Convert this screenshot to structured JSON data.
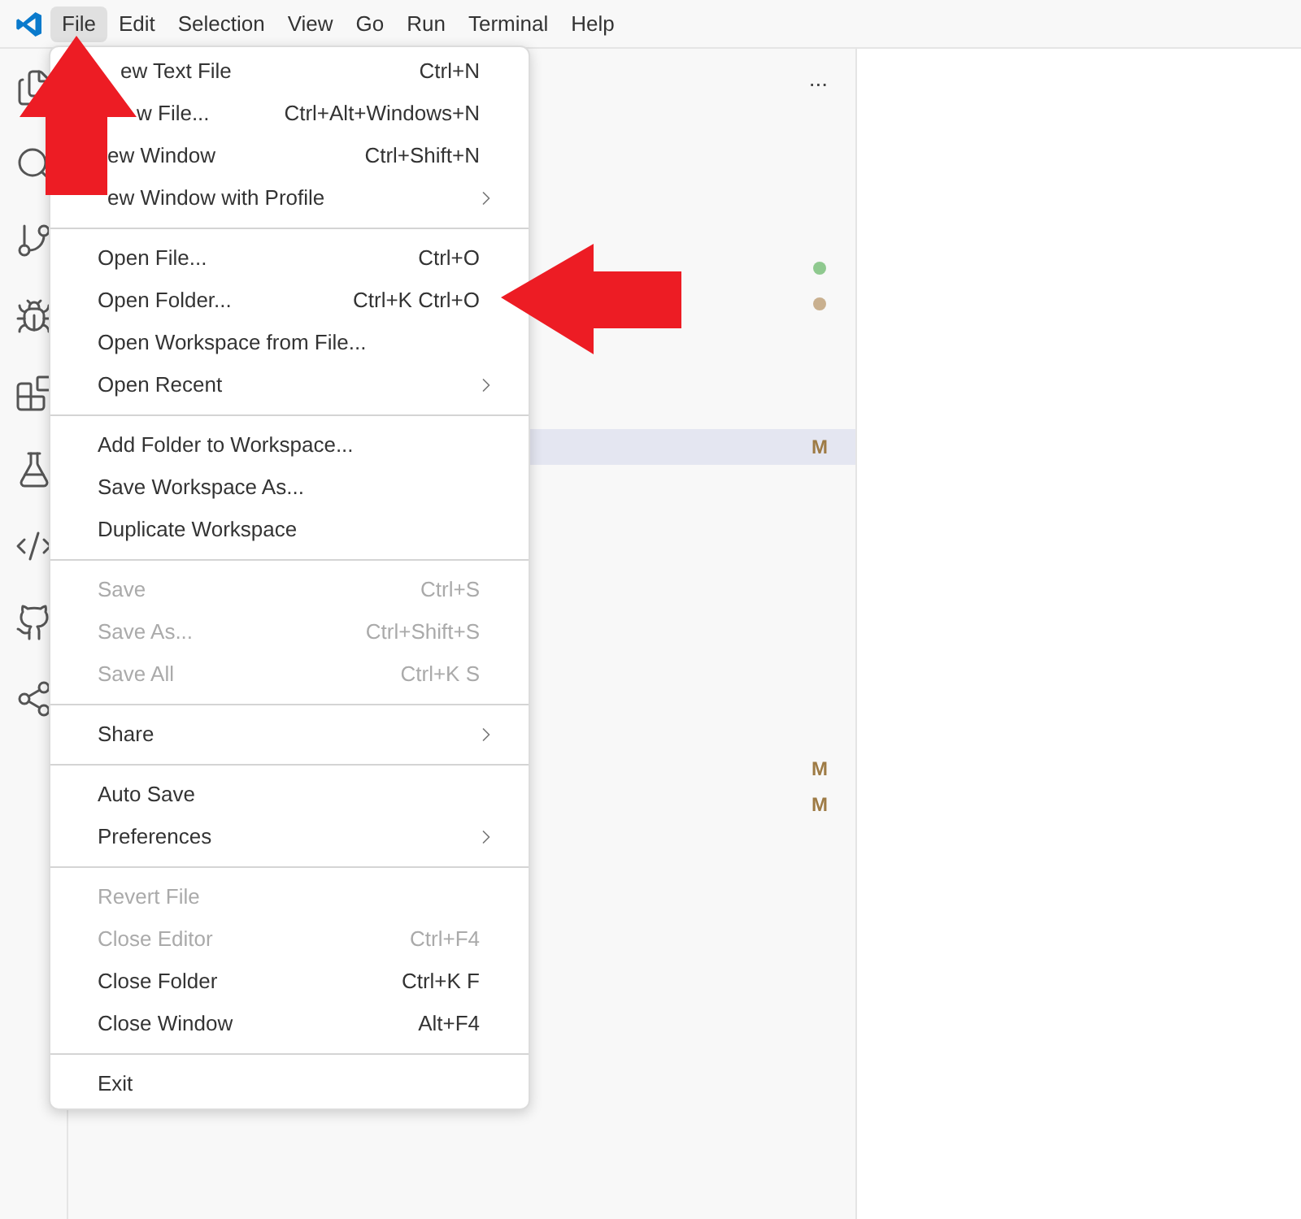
{
  "menu_bar": [
    {
      "label": "File",
      "selected": true
    },
    {
      "label": "Edit",
      "selected": false
    },
    {
      "label": "Selection",
      "selected": false
    },
    {
      "label": "View",
      "selected": false
    },
    {
      "label": "Go",
      "selected": false
    },
    {
      "label": "Run",
      "selected": false
    },
    {
      "label": "Terminal",
      "selected": false
    },
    {
      "label": "Help",
      "selected": false
    }
  ],
  "file_menu": [
    [
      {
        "label": "ew Text File",
        "shortcut": "Ctrl+N",
        "submenu": false,
        "disabled": false
      },
      {
        "label": "w File...",
        "shortcut": "Ctrl+Alt+Windows+N",
        "submenu": false,
        "disabled": false
      },
      {
        "label": "ew Window",
        "shortcut": "Ctrl+Shift+N",
        "submenu": false,
        "disabled": false
      },
      {
        "label": "ew Window with Profile",
        "submenu": true,
        "disabled": false
      }
    ],
    [
      {
        "label": "Open File...",
        "shortcut": "Ctrl+O",
        "submenu": false,
        "disabled": false
      },
      {
        "label": "Open Folder...",
        "shortcut": "Ctrl+K Ctrl+O",
        "submenu": false,
        "disabled": false
      },
      {
        "label": "Open Workspace from File...",
        "submenu": false,
        "disabled": false
      },
      {
        "label": "Open Recent",
        "submenu": true,
        "disabled": false
      }
    ],
    [
      {
        "label": "Add Folder to Workspace...",
        "submenu": false,
        "disabled": false
      },
      {
        "label": "Save Workspace As...",
        "submenu": false,
        "disabled": false
      },
      {
        "label": "Duplicate Workspace",
        "submenu": false,
        "disabled": false
      }
    ],
    [
      {
        "label": "Save",
        "shortcut": "Ctrl+S",
        "submenu": false,
        "disabled": true
      },
      {
        "label": "Save As...",
        "shortcut": "Ctrl+Shift+S",
        "submenu": false,
        "disabled": true
      },
      {
        "label": "Save All",
        "shortcut": "Ctrl+K S",
        "submenu": false,
        "disabled": true
      }
    ],
    [
      {
        "label": "Share",
        "submenu": true,
        "disabled": false
      }
    ],
    [
      {
        "label": "Auto Save",
        "submenu": false,
        "disabled": false
      },
      {
        "label": "Preferences",
        "submenu": true,
        "disabled": false
      }
    ],
    [
      {
        "label": "Revert File",
        "submenu": false,
        "disabled": true
      },
      {
        "label": "Close Editor",
        "shortcut": "Ctrl+F4",
        "submenu": false,
        "disabled": true
      },
      {
        "label": "Close Folder",
        "shortcut": "Ctrl+K F",
        "submenu": false,
        "disabled": false
      },
      {
        "label": "Close Window",
        "shortcut": "Alt+F4",
        "submenu": false,
        "disabled": false
      }
    ],
    [
      {
        "label": "Exit",
        "submenu": false,
        "disabled": false
      }
    ]
  ],
  "explorer": {
    "more": "...",
    "rows": [
      {
        "kind": "blank"
      },
      {
        "kind": "blank"
      },
      {
        "kind": "blank"
      },
      {
        "kind": "blank"
      },
      {
        "kind": "dot",
        "color": "#8fc98f"
      },
      {
        "kind": "dot",
        "color": "#c9b08f"
      },
      {
        "kind": "blank"
      },
      {
        "kind": "blank"
      },
      {
        "kind": "blank"
      },
      {
        "kind": "status",
        "text": "M",
        "selected": true
      },
      {
        "kind": "blank"
      },
      {
        "kind": "blank"
      },
      {
        "kind": "blank"
      },
      {
        "kind": "blank"
      },
      {
        "kind": "blank"
      },
      {
        "kind": "blank"
      },
      {
        "kind": "blank"
      },
      {
        "kind": "blank"
      },
      {
        "kind": "status",
        "text": "M",
        "selected": false
      },
      {
        "kind": "status",
        "text": "M",
        "selected": false
      }
    ]
  }
}
